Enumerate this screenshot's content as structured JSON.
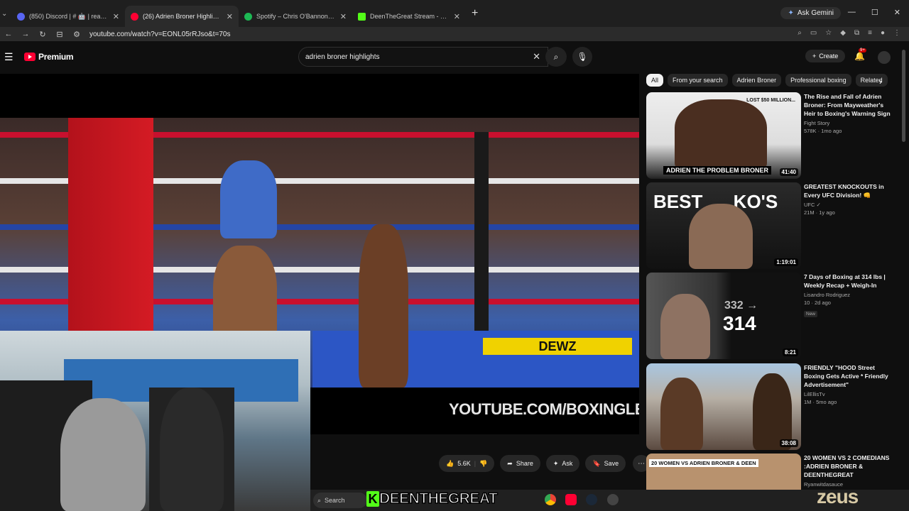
{
  "browser": {
    "tabs": [
      {
        "title": "(850) Discord | # 🤖 | reactions",
        "fav_color": "#5865F2",
        "active": false
      },
      {
        "title": "(26) Adrien Broner Highlights G",
        "fav_color": "#ff0033",
        "active": true
      },
      {
        "title": "Spotify – Chris O'Bannon - Disc",
        "fav_color": "#1DB954",
        "active": false
      },
      {
        "title": "DeenTheGreat Stream - Watch",
        "fav_color": "#53fc18",
        "active": false
      }
    ],
    "new_tab": "+",
    "gemini_label": "Ask Gemini",
    "url": "youtube.com/watch?v=EONL05rRJso&t=70s"
  },
  "youtube": {
    "logo_text": "Premium",
    "search_value": "adrien broner highlights",
    "create_label": "Create",
    "notif_badge": "9+",
    "video_watermark": "YOUTUBE.COM/BOXINGLEGENDSTV",
    "ring_sign": "DEWZ",
    "actions": {
      "likes": "5.6K",
      "share": "Share",
      "ask": "Ask",
      "save": "Save"
    },
    "chips": [
      "All",
      "From your search",
      "Adrien Broner",
      "Professional boxing",
      "Related"
    ],
    "recommendations": [
      {
        "title": "The Rise and Fall of Adrien Broner: From Mayweather's Heir to Boxing's Warning Sign",
        "channel": "Fight Story",
        "stats": "578K · 1mo ago",
        "duration": "41:40",
        "thumb_text": "ADRIEN THE PROBLEM BRONER",
        "thumb_sub": "LOST $50 MILLION...",
        "new": ""
      },
      {
        "title": "GREATEST KNOCKOUTS in Every UFC Division! 👊",
        "channel": "UFC ✓",
        "stats": "21M · 1y ago",
        "duration": "1:19:01",
        "thumb_text": "BEST      KO'S",
        "thumb_sub": "",
        "new": ""
      },
      {
        "title": "7 Days of Boxing at 314 lbs | Weekly Recap + Weigh-In",
        "channel": "Lisandro Rodriguez",
        "stats": "10 · 2d ago",
        "duration": "8:21",
        "thumb_text": "314",
        "thumb_sub": "332 →",
        "new": "New"
      },
      {
        "title": "FRIENDLY \"HOOD Street Boxing Gets Active * Friendly Advertisement\" Tx*SUBSCRIBE...",
        "channel": "LilEllisTv",
        "stats": "1M · 5mo ago",
        "duration": "38:08",
        "thumb_text": "",
        "thumb_sub": "",
        "new": ""
      },
      {
        "title": "20 WOMEN VS 2 COMEDIANS :ADRIEN BRONER & DEENTHEGREAT",
        "channel": "Ryanwitdasauce",
        "stats": "",
        "duration": "",
        "thumb_text": "20 WOMEN VS ADRIEN BRONER & DEEN",
        "thumb_sub": "",
        "new": ""
      }
    ]
  },
  "taskbar": {
    "search_label": "Search",
    "streamer_name": "DEENTHEGREAT",
    "stream_brand": "zeus"
  }
}
